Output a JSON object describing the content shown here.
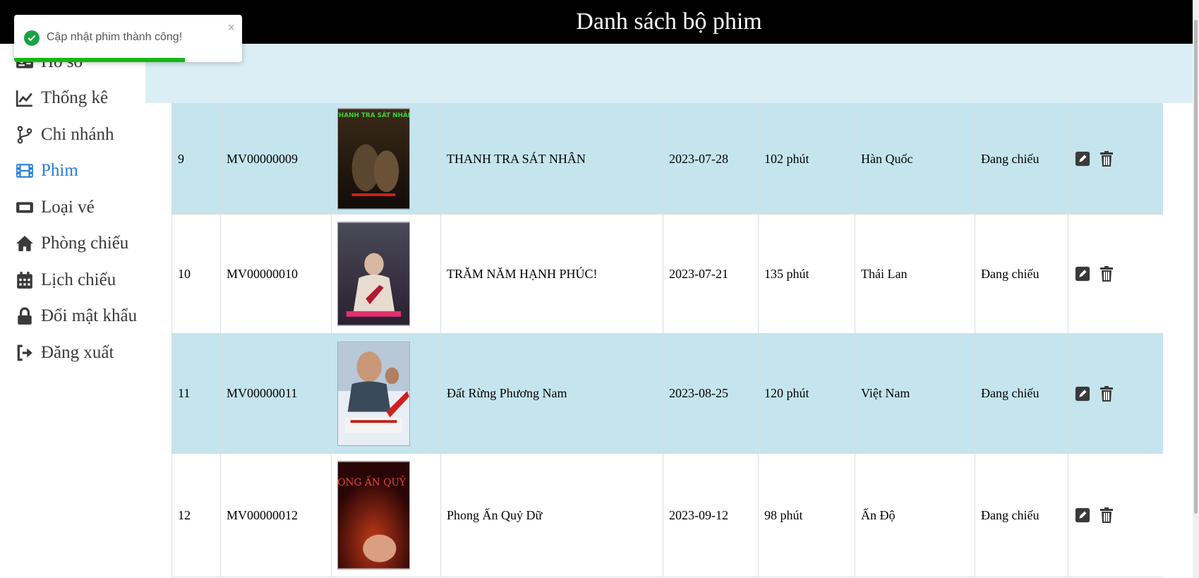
{
  "header": {
    "title": "Danh sách bộ phim"
  },
  "sidebar": {
    "items": [
      {
        "label": "Hồ sơ",
        "icon": "id-card-icon"
      },
      {
        "label": "Thống kê",
        "icon": "line-chart-icon"
      },
      {
        "label": "Chi nhánh",
        "icon": "code-branch-icon"
      },
      {
        "label": "Phim",
        "icon": "film-icon"
      },
      {
        "label": "Loại vé",
        "icon": "ticket-icon"
      },
      {
        "label": "Phòng chiếu",
        "icon": "home-icon"
      },
      {
        "label": "Lịch chiếu",
        "icon": "calendar-icon"
      },
      {
        "label": "Đổi mật khẩu",
        "icon": "lock-icon"
      },
      {
        "label": "Đăng xuất",
        "icon": "sign-out-icon"
      }
    ],
    "active_color": "#2b7ed9"
  },
  "toast": {
    "message": "Cập nhật phim thành công!",
    "close": "×",
    "progress": 0.75
  },
  "movies": [
    {
      "stt": "9",
      "code": "MV00000009",
      "name": "THANH TRA SÁT NHÂN",
      "release": "2023-07-28",
      "duration": "102 phút",
      "country": "Hàn Quốc",
      "status": "Đang chiếu",
      "poster_text": "THANH TRA SÁT NHÂN"
    },
    {
      "stt": "10",
      "code": "MV00000010",
      "name": "TRĂM NĂM HẠNH PHÚC!",
      "release": "2023-07-21",
      "duration": "135 phút",
      "country": "Thái Lan",
      "status": "Đang chiếu",
      "poster_text": ""
    },
    {
      "stt": "11",
      "code": "MV00000011",
      "name": "Đất Rừng Phương Nam",
      "release": "2023-08-25",
      "duration": "120 phút",
      "country": "Việt Nam",
      "status": "Đang chiếu",
      "poster_text": ""
    },
    {
      "stt": "12",
      "code": "MV00000012",
      "name": "Phong Ấn Quỷ Dữ",
      "release": "2023-09-12",
      "duration": "98 phút",
      "country": "Ấn Độ",
      "status": "Đang chiếu",
      "poster_text": "PHONG ẤN QUỶ DỮ"
    }
  ],
  "colors": {
    "row_alt": "#c5e5ee",
    "header_bg": "#000000",
    "filter_bg": "#dbeef5",
    "toast_success": "#1aa346"
  }
}
